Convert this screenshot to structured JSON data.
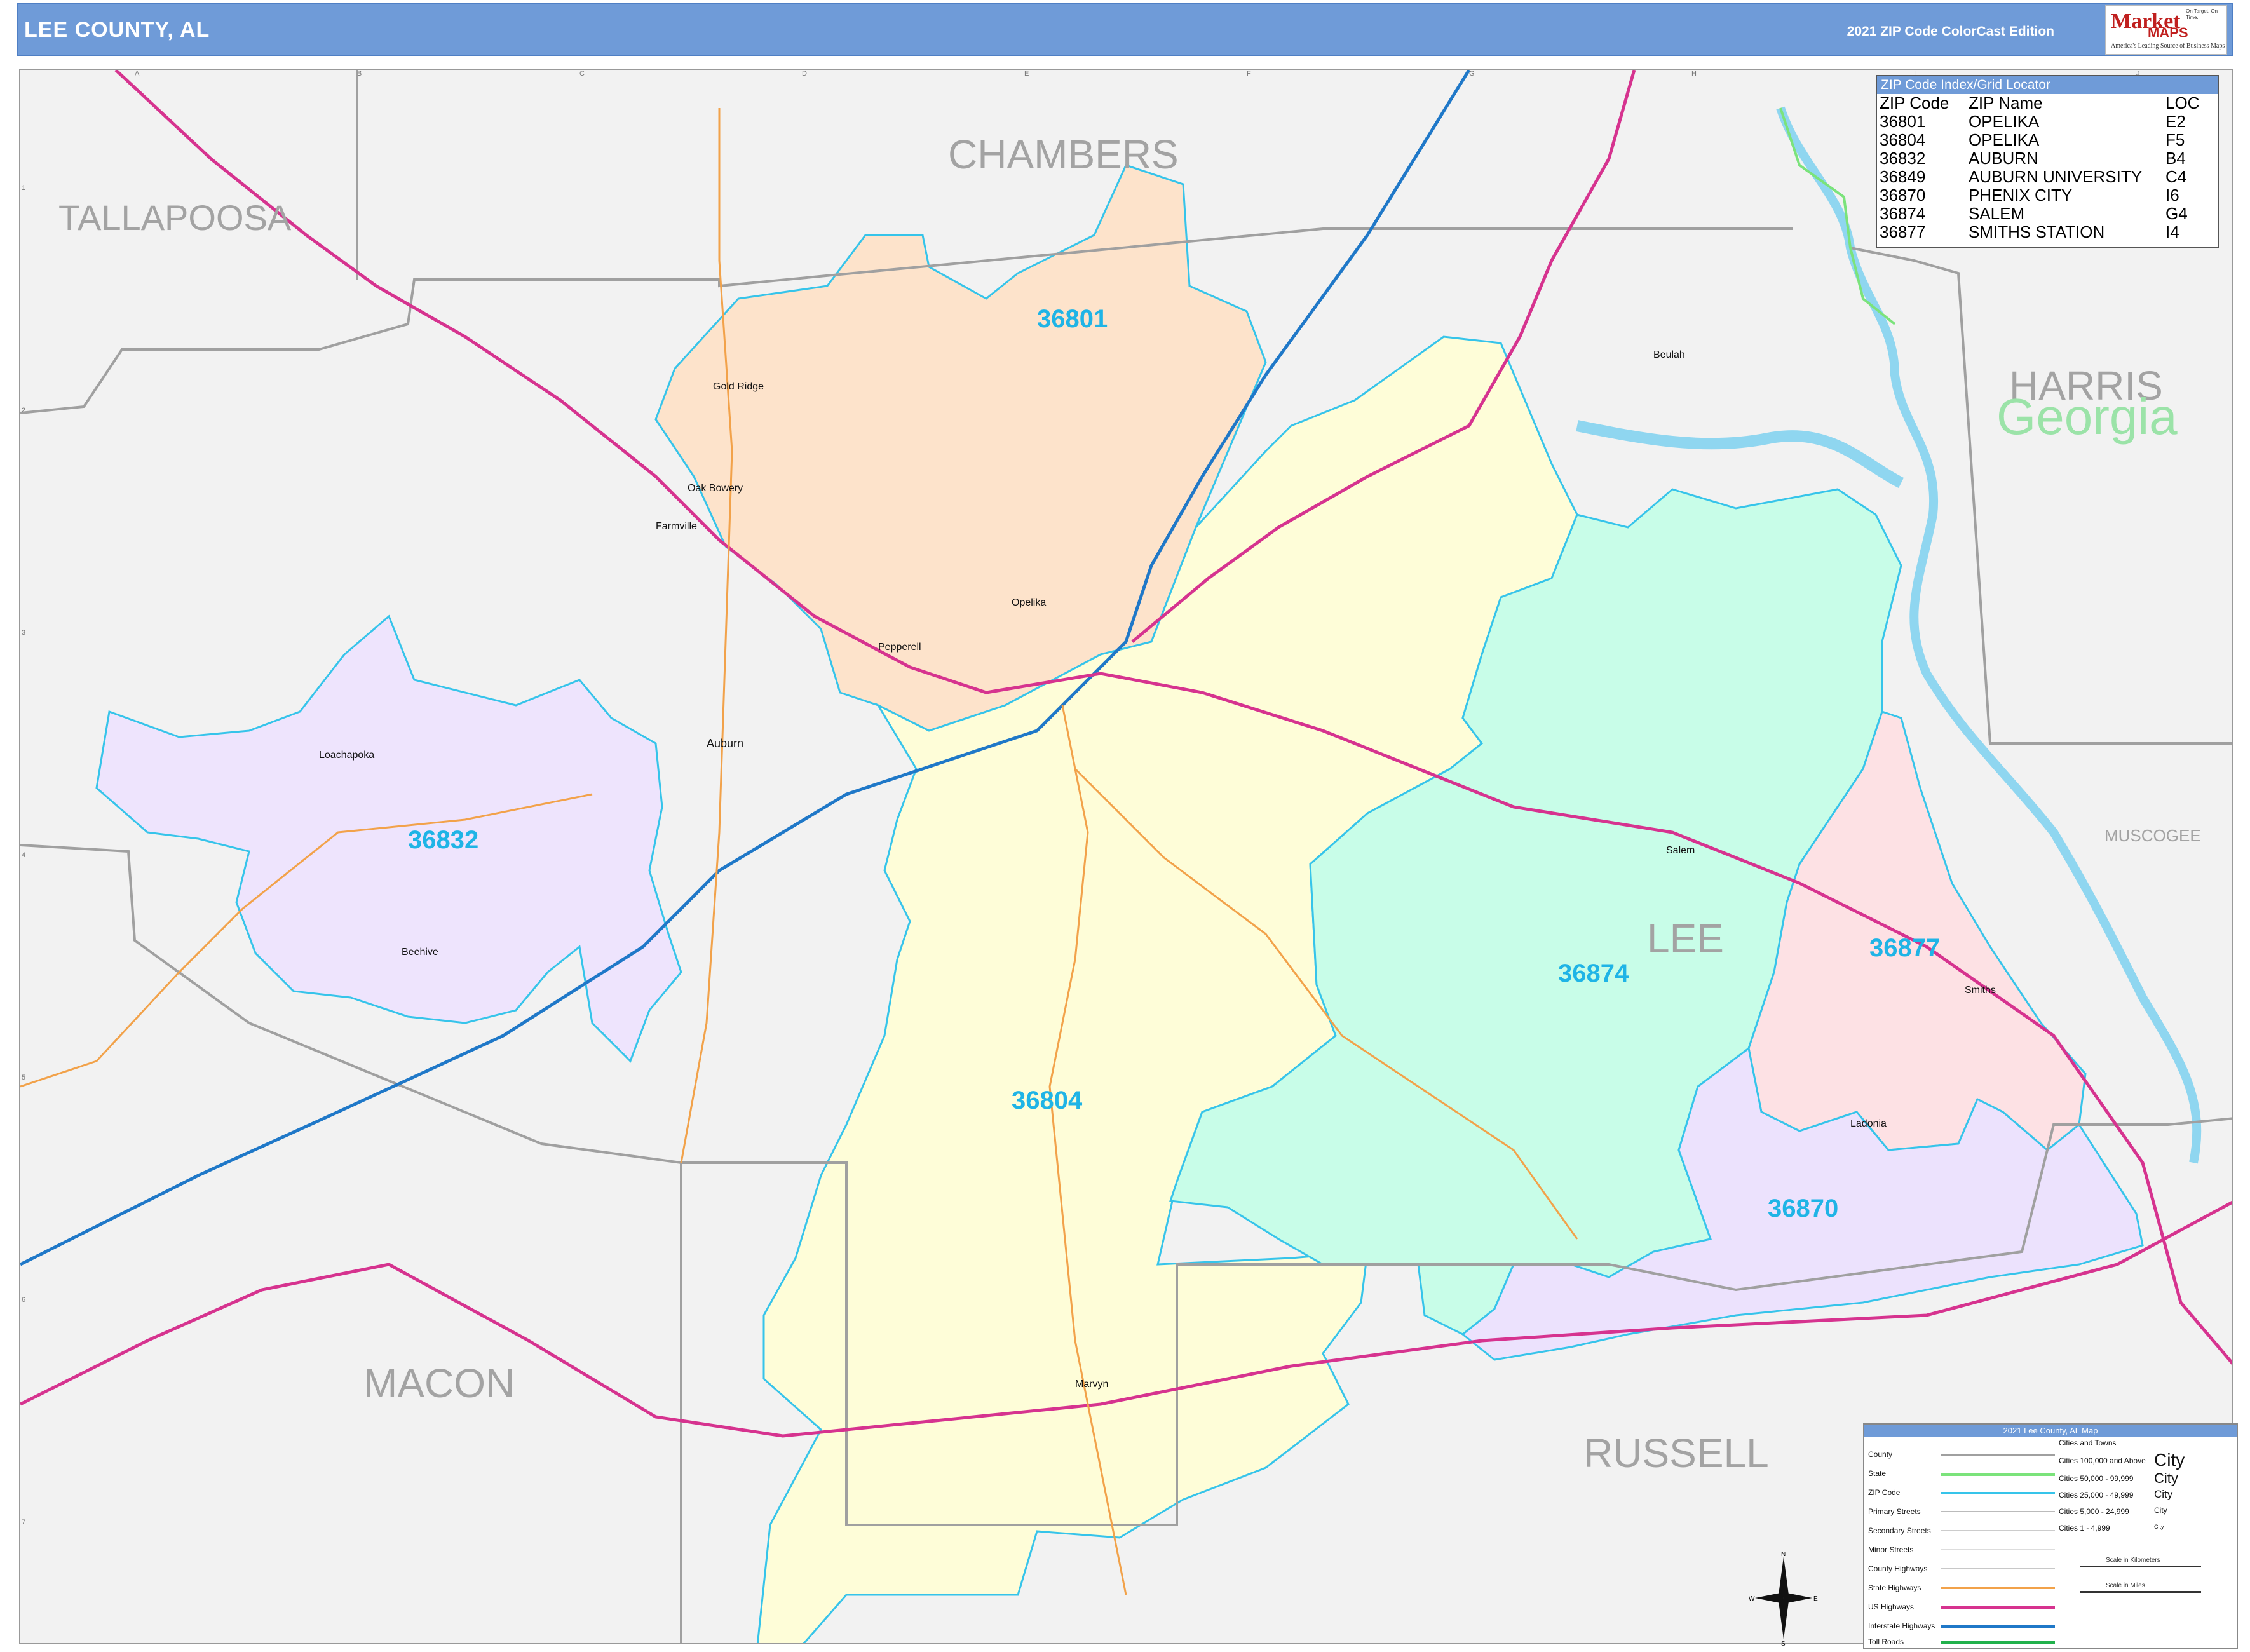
{
  "header": {
    "title": "LEE COUNTY, AL",
    "edition": "2021 ZIP Code ColorCast Edition",
    "logo_text": "Market",
    "logo_maps": "MAPS",
    "logo_tagline": "America's Leading Source of Business Maps",
    "logo_slogan": "On Target. On Time."
  },
  "counties": [
    {
      "name": "CHAMBERS"
    },
    {
      "name": "TALLAPOOSA"
    },
    {
      "name": "HARRIS"
    },
    {
      "name": "MUSCOGEE"
    },
    {
      "name": "LEE"
    },
    {
      "name": "MACON"
    },
    {
      "name": "RUSSELL"
    }
  ],
  "state_label": "Georgia",
  "zip_areas": [
    {
      "zip": "36801",
      "color": "#fde3cb"
    },
    {
      "zip": "36804",
      "color": "#fefdd8"
    },
    {
      "zip": "36832",
      "color": "#eee4fd"
    },
    {
      "zip": "36874",
      "color": "#c8fde8"
    },
    {
      "zip": "36877",
      "color": "#fde1e4"
    },
    {
      "zip": "36870",
      "color": "#ece2fd"
    }
  ],
  "cities": [
    "Opelika",
    "Auburn",
    "Pepperell",
    "Loachapoka",
    "Beehive",
    "Gold Ridge",
    "Oak Bowery",
    "Farmville",
    "Beulah",
    "Salem",
    "Smiths",
    "Marvyn",
    "Ladonia"
  ],
  "zip_index": {
    "title": "ZIP Code Index/Grid Locator",
    "columns": [
      "ZIP Code",
      "ZIP Name",
      "LOC"
    ],
    "rows": [
      [
        "36801",
        "OPELIKA",
        "E2"
      ],
      [
        "36804",
        "OPELIKA",
        "F5"
      ],
      [
        "36832",
        "AUBURN",
        "B4"
      ],
      [
        "36849",
        "AUBURN UNIVERSITY",
        "C4"
      ],
      [
        "36870",
        "PHENIX CITY",
        "I6"
      ],
      [
        "36874",
        "SALEM",
        "G4"
      ],
      [
        "36877",
        "SMITHS STATION",
        "I4"
      ]
    ]
  },
  "legend": {
    "title": "2021 Lee County, AL Map",
    "items": [
      "County",
      "State",
      "ZIP Code",
      "Primary Streets",
      "Secondary Streets",
      "Minor Streets",
      "County Highways",
      "State Highways",
      "US Highways",
      "Interstate Highways",
      "Toll Roads"
    ],
    "colors": {
      "County": "#a0a0a0",
      "State": "#7be37b",
      "ZIP Code": "#36c4ea",
      "US Highways": "#d6338f",
      "Interstate Highways": "#1f78c8",
      "Toll Roads": "#22b14c",
      "State Highways": "#f2a24a"
    },
    "cities_title": "Cities and Towns",
    "city_classes": [
      "Cities 100,000 and Above",
      "Cities 50,000 - 99,999",
      "Cities 25,000 - 49,999",
      "Cities 5,000 - 24,999",
      "Cities 1 - 4,999"
    ],
    "city_samples": [
      "City",
      "City",
      "City",
      "City",
      "City"
    ],
    "scale_km": "Scale in Kilometers",
    "scale_mi": "Scale in Miles"
  },
  "compass": {
    "n": "N",
    "s": "S",
    "e": "E",
    "w": "W"
  },
  "grid": {
    "cols": [
      "A",
      "B",
      "C",
      "D",
      "E",
      "F",
      "G",
      "H",
      "I",
      "J"
    ],
    "rows": [
      "1",
      "2",
      "3",
      "4",
      "5",
      "6",
      "7"
    ]
  }
}
